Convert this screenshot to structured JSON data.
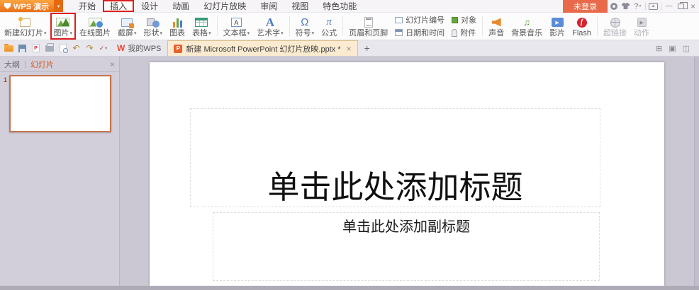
{
  "titlebar": {
    "logo_text": "WPS 演示",
    "menus": [
      "开始",
      "插入",
      "设计",
      "动画",
      "幻灯片放映",
      "审阅",
      "视图",
      "特色功能"
    ],
    "login_label": "未登录",
    "help_label": "?"
  },
  "tabbar": {
    "wps_tab_label": "我的WPS",
    "document_tab_label": "新建 Microsoft PowerPoint 幻灯片放映.pptx *"
  },
  "ribbon": {
    "buttons": [
      {
        "label": "新建幻灯片"
      },
      {
        "label": "图片"
      },
      {
        "label": "在线图片"
      },
      {
        "label": "截屏"
      },
      {
        "label": "形状"
      },
      {
        "label": "图表"
      },
      {
        "label": "表格"
      },
      {
        "label": "文本框"
      },
      {
        "label": "艺术字"
      },
      {
        "label": "符号"
      },
      {
        "label": "公式"
      },
      {
        "label": "页眉和页脚"
      },
      {
        "label": "幻灯片编号"
      },
      {
        "label": "对象"
      },
      {
        "label": "日期和时间"
      },
      {
        "label": "附件"
      },
      {
        "label": "声音"
      },
      {
        "label": "背景音乐"
      },
      {
        "label": "影片"
      },
      {
        "label": "Flash"
      },
      {
        "label": "超链接"
      },
      {
        "label": "动作"
      }
    ]
  },
  "sidebar": {
    "outline_tab": "大纲",
    "slides_tab": "幻灯片",
    "tab_divider": "|",
    "slide_number": "1"
  },
  "slide": {
    "title_placeholder": "单击此处添加标题",
    "subtitle_placeholder": "单击此处添加副标题"
  },
  "icons": {
    "undo": "↶",
    "redo": "↷",
    "customize_check": "✓",
    "close": "×",
    "minimize": "—",
    "plus": "+",
    "textbox_a": "A",
    "wordart_a": "A",
    "omega": "Ω",
    "pi": "π",
    "music_note": "♫",
    "wps_w": "W",
    "tab_tool_1": "⊞",
    "tab_tool_2": "▣",
    "tab_tool_3": "◫"
  },
  "colors": {
    "accent_orange": "#ec7018",
    "annotation_red": "#de1d1e",
    "thumbnail_selection": "#c8744b",
    "login_button": "#e96a4a",
    "active_doc_tab": "#fcebd0"
  }
}
